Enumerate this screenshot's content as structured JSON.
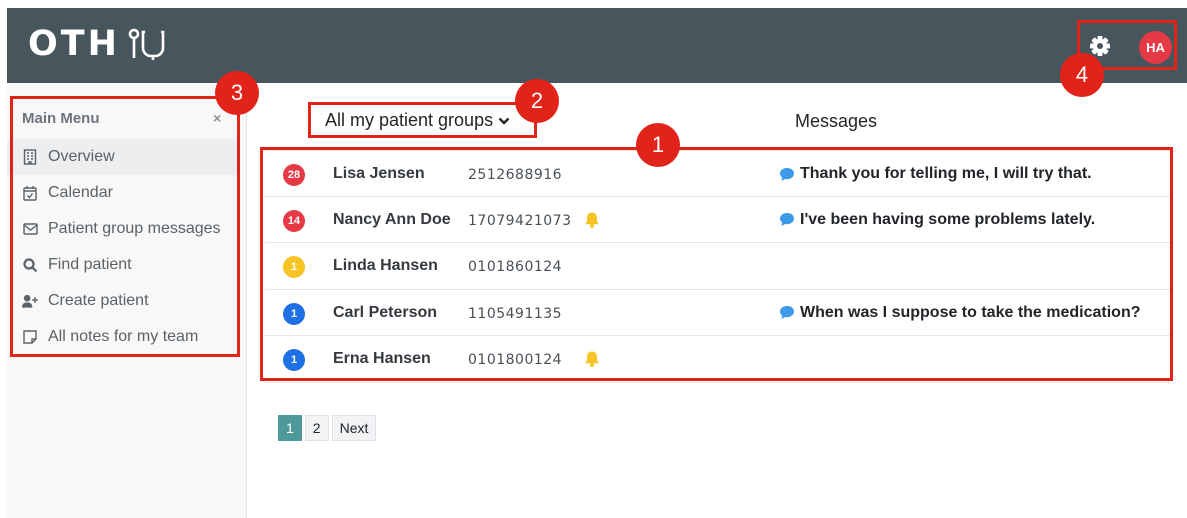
{
  "header": {
    "logo_text": "OTH",
    "logo_mark_icon": "stethoscope-icon",
    "settings_icon": "gear-icon",
    "avatar_initials": "HA"
  },
  "sidebar": {
    "title": "Main Menu",
    "close_icon": "×",
    "items": [
      {
        "label": "Overview",
        "icon": "building-icon",
        "active": true
      },
      {
        "label": "Calendar",
        "icon": "calendar-check-icon"
      },
      {
        "label": "Patient group messages",
        "icon": "envelope-icon"
      },
      {
        "label": "Find patient",
        "icon": "search-icon"
      },
      {
        "label": "Create patient",
        "icon": "user-plus-icon"
      },
      {
        "label": "All notes for my team",
        "icon": "note-icon"
      }
    ]
  },
  "main": {
    "group_selector": "All my patient groups",
    "messages_header": "Messages",
    "patients": [
      {
        "count": "28",
        "badge_color": "#e53945",
        "name": "Lisa Jensen",
        "id": "2512688916",
        "alarm": false,
        "message": "Thank you for telling me, I will try that."
      },
      {
        "count": "14",
        "badge_color": "#e53945",
        "name": "Nancy Ann Doe",
        "id": "17079421073",
        "alarm": true,
        "message": "I've been having some problems lately."
      },
      {
        "count": "1",
        "badge_color": "#f7c325",
        "name": "Linda Hansen",
        "id": "0101860124",
        "alarm": false,
        "message": ""
      },
      {
        "count": "1",
        "badge_color": "#1f6fe5",
        "name": "Carl Peterson",
        "id": "1105491135",
        "alarm": false,
        "message": "When was I suppose to take the medication?"
      },
      {
        "count": "1",
        "badge_color": "#1f6fe5",
        "name": "Erna Hansen",
        "id": "0101800124",
        "alarm": true,
        "message": ""
      }
    ]
  },
  "pagination": {
    "pages": [
      "1",
      "2"
    ],
    "active": "1",
    "next": "Next"
  },
  "annotations": {
    "markers": [
      "1",
      "2",
      "3",
      "4"
    ],
    "color": "#e2231a"
  },
  "colors": {
    "topbar": "#47555c",
    "accent": "#4e9999",
    "message_icon": "#3d9ae8",
    "bell_icon": "#f7c325"
  }
}
